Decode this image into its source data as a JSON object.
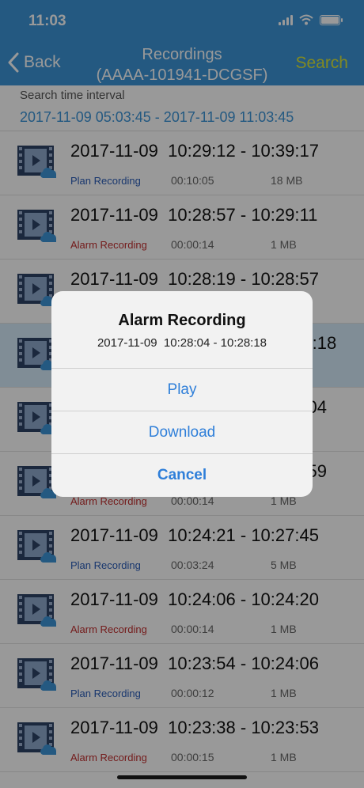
{
  "status_bar": {
    "time": "11:03"
  },
  "nav": {
    "back_label": "Back",
    "title": "Recordings",
    "subtitle": "(AAAA-101941-DCGSF)",
    "search_label": "Search"
  },
  "interval": {
    "label": "Search time interval",
    "range": "2017-11-09 05:03:45 - 2017-11-09 11:03:45"
  },
  "recordings": [
    {
      "title": "2017-11-09  10:29:12 - 10:39:17",
      "type": "Plan Recording",
      "kind": "plan",
      "duration": "00:10:05",
      "size": "18 MB"
    },
    {
      "title": "2017-11-09  10:28:57 - 10:29:11",
      "type": "Alarm Recording",
      "kind": "alarm",
      "duration": "00:00:14",
      "size": "1 MB"
    },
    {
      "title": "2017-11-09  10:28:19 - 10:28:57",
      "type": "",
      "kind": "plan",
      "duration": "",
      "size": ""
    },
    {
      "title": "                                                8:18",
      "type": "",
      "kind": "alarm",
      "duration": "",
      "size": "",
      "highlight": true
    },
    {
      "title": "                                                :04",
      "type": "",
      "kind": "plan",
      "duration": "",
      "size": ""
    },
    {
      "title": "                                                :59",
      "type": "Alarm Recording",
      "kind": "alarm",
      "duration": "00:00:14",
      "size": "1 MB"
    },
    {
      "title": "2017-11-09  10:24:21 - 10:27:45",
      "type": "Plan Recording",
      "kind": "plan",
      "duration": "00:03:24",
      "size": "5 MB"
    },
    {
      "title": "2017-11-09  10:24:06 - 10:24:20",
      "type": "Alarm Recording",
      "kind": "alarm",
      "duration": "00:00:14",
      "size": "1 MB"
    },
    {
      "title": "2017-11-09  10:23:54 - 10:24:06",
      "type": "Plan Recording",
      "kind": "plan",
      "duration": "00:00:12",
      "size": "1 MB"
    },
    {
      "title": "2017-11-09  10:23:38 - 10:23:53",
      "type": "Alarm Recording",
      "kind": "alarm",
      "duration": "00:00:15",
      "size": "1 MB"
    }
  ],
  "dialog": {
    "title": "Alarm Recording",
    "subtitle": "2017-11-09  10:28:04 - 10:28:18",
    "play_label": "Play",
    "download_label": "Download",
    "cancel_label": "Cancel"
  },
  "icons": {
    "back": "chevron-left-icon",
    "thumb": "video-thumbnail-icon",
    "cloud": "cloud-icon"
  },
  "colors": {
    "header": "#3d95d8",
    "search": "#d8e53a",
    "plan": "#2a5db8",
    "alarm": "#c23030",
    "dialog_button": "#2f7fd9"
  }
}
